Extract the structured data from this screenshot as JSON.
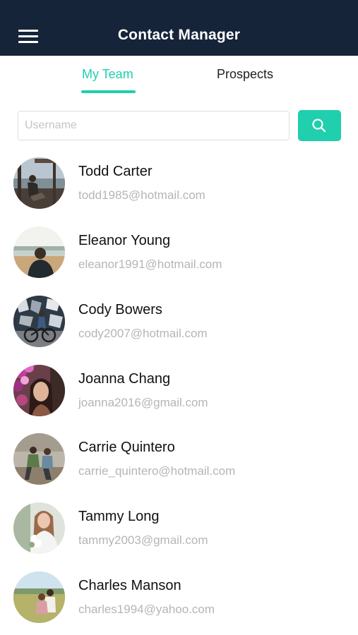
{
  "header": {
    "title": "Contact Manager",
    "menu_icon": "hamburger-menu-icon",
    "background": "#16243a"
  },
  "tabs": [
    {
      "label": "My Team",
      "active": true
    },
    {
      "label": "Prospects",
      "active": false
    }
  ],
  "accent_color": "#1fcfae",
  "search": {
    "placeholder": "Username",
    "value": "",
    "button_icon": "search-icon"
  },
  "contacts": [
    {
      "name": "Todd Carter",
      "email": "todd1985@hotmail.com",
      "avatar": "man-on-pier-photo"
    },
    {
      "name": "Eleanor Young",
      "email": "eleanor1991@hotmail.com",
      "avatar": "person-by-lake-photo"
    },
    {
      "name": "Cody Bowers",
      "email": "cody2007@hotmail.com",
      "avatar": "cyclist-with-graffiti-photo"
    },
    {
      "name": "Joanna Chang",
      "email": "joanna2016@gmail.com",
      "avatar": "woman-with-flowers-photo"
    },
    {
      "name": "Carrie Quintero",
      "email": "carrie_quintero@hotmail.com",
      "avatar": "couple-sitting-photo"
    },
    {
      "name": "Tammy Long",
      "email": "tammy2003@gmail.com",
      "avatar": "bride-with-bouquet-photo"
    },
    {
      "name": "Charles Manson",
      "email": "charles1994@yahoo.com",
      "avatar": "couple-in-field-photo"
    }
  ]
}
